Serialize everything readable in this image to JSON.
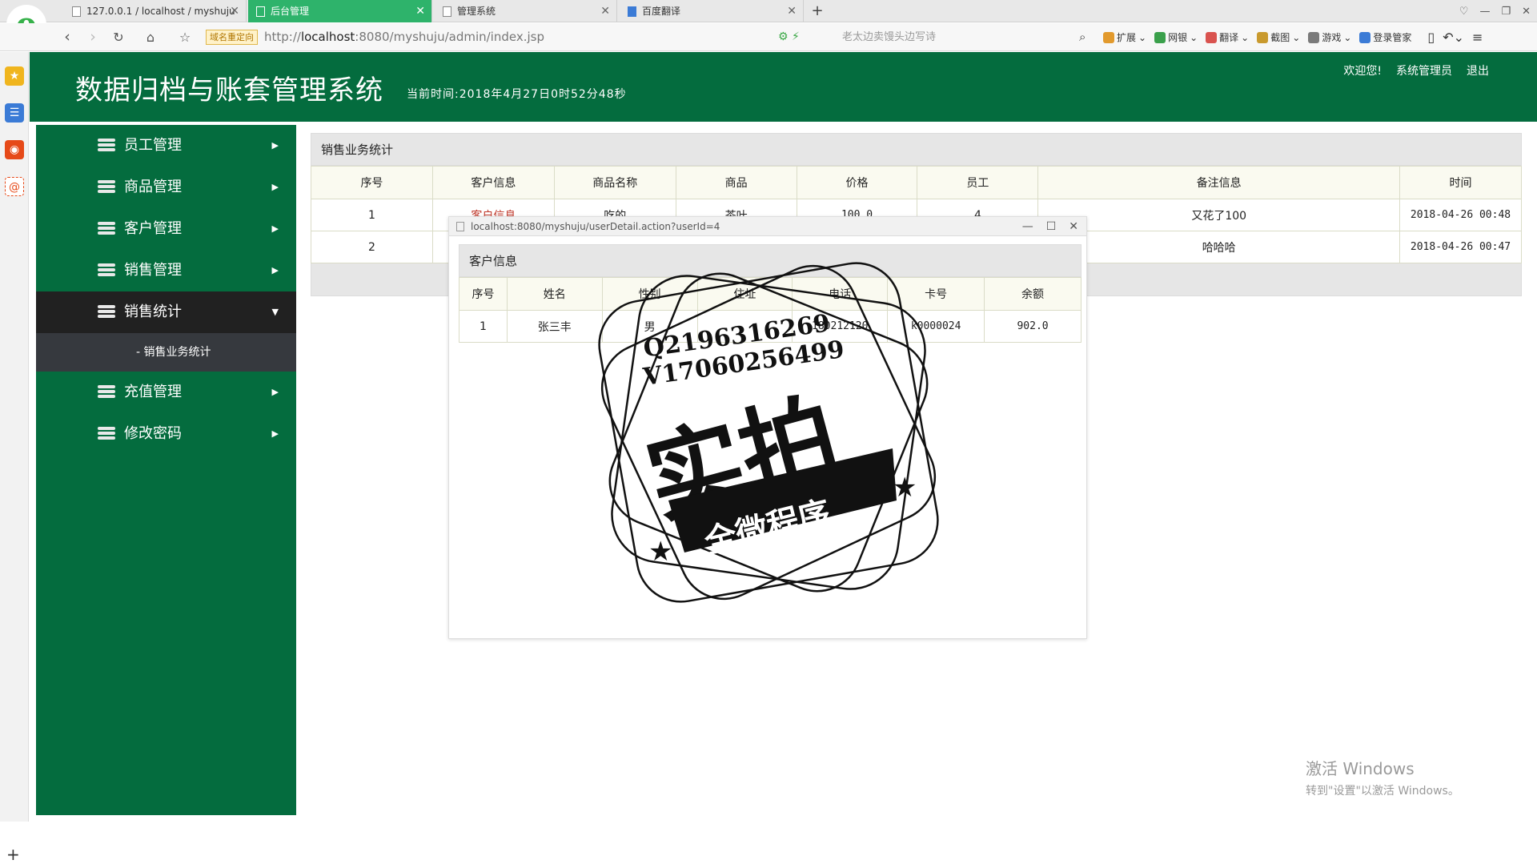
{
  "browser": {
    "tabs": [
      {
        "label": "127.0.0.1 / localhost / myshuju",
        "active": false
      },
      {
        "label": "后台管理",
        "active": true
      },
      {
        "label": "管理系统",
        "active": false
      },
      {
        "label": "百度翻译",
        "active": false
      }
    ],
    "redirect_badge": "域名重定向",
    "url_prefix": "http://",
    "url_host": "localhost",
    "url_rest": ":8080/myshuju/admin/index.jsp",
    "search_placeholder": "老太边卖馒头边写诗",
    "toolbar_items": [
      "扩展",
      "网银",
      "翻译",
      "截图",
      "游戏",
      "登录管家"
    ]
  },
  "header": {
    "title": "数据归档与账套管理系统",
    "time_label": "当前时间:",
    "time_value": "2018年4月27日0时52分48秒",
    "welcome": "欢迎您!",
    "user": "系统管理员",
    "logout": "退出"
  },
  "sidebar": {
    "items": [
      {
        "label": "员工管理"
      },
      {
        "label": "商品管理"
      },
      {
        "label": "客户管理"
      },
      {
        "label": "销售管理"
      },
      {
        "label": "销售统计"
      },
      {
        "label": "充值管理"
      },
      {
        "label": "修改密码"
      }
    ],
    "submenu": "- 销售业务统计"
  },
  "main": {
    "panel_title": "销售业务统计",
    "columns": [
      "序号",
      "客户信息",
      "商品名称",
      "商品",
      "价格",
      "员工",
      "备注信息",
      "时间"
    ],
    "rows": [
      {
        "no": "1",
        "customer": "客户信息",
        "product_name": "吃的",
        "product": "茶叶",
        "price": "100.0",
        "staff": "4",
        "remark": "又花了100",
        "time": "2018-04-26 00:48"
      },
      {
        "no": "2",
        "remark": "哈哈哈",
        "time": "2018-04-26 00:47"
      }
    ]
  },
  "popup": {
    "url": "localhost:8080/myshuju/userDetail.action?userId=4",
    "panel_title": "客户信息",
    "columns": [
      "序号",
      "姓名",
      "性别",
      "住址",
      "电话",
      "卡号",
      "余额"
    ],
    "row": {
      "no": "1",
      "name": "张三丰",
      "gender": "男",
      "address": "",
      "phone": "180212120",
      "card": "k0000024",
      "balance": "902.0"
    }
  },
  "watermark": {
    "contact_q": "Q2196316269",
    "contact_v": "V17060256499",
    "main": "实拍",
    "ribbon": "全微程序"
  },
  "windows_activation": {
    "line1": "激活 Windows",
    "line2": "转到\"设置\"以激活 Windows。"
  }
}
